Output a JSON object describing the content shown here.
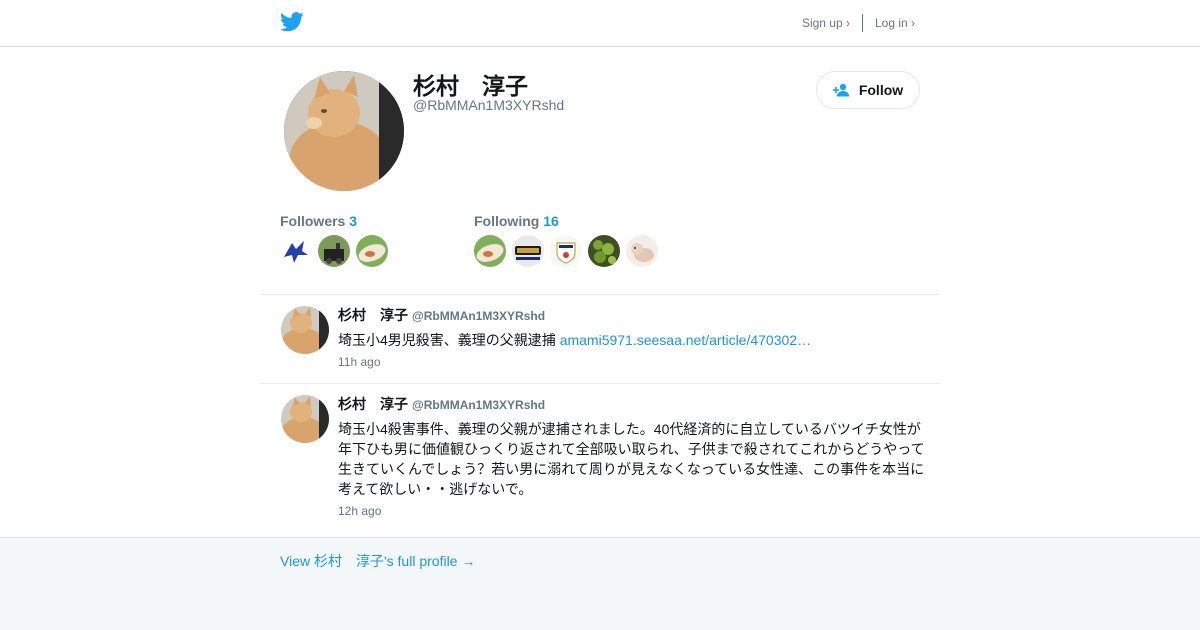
{
  "header": {
    "logo_icon": "twitter-bird-icon",
    "signup_label": "Sign up ›",
    "login_label": "Log in ›"
  },
  "profile": {
    "name": "杉村　淳子",
    "handle": "@RbMMAn1M3XYRshd",
    "follow_label": "Follow",
    "follow_icon": "add-person-icon",
    "followers_label": "Followers",
    "followers_count": "3",
    "following_label": "Following",
    "following_count": "16"
  },
  "tweets": [
    {
      "name": "杉村　淳子",
      "handle": "@RbMMAn1M3XYRshd",
      "text": "埼玉小4男児殺害、義理の父親逮捕 ",
      "link": "amami5971.seesaa.net/article/470302…",
      "time": "11h ago"
    },
    {
      "name": "杉村　淳子",
      "handle": "@RbMMAn1M3XYRshd",
      "text": "埼玉小4殺害事件、義理の父親が逮捕されました。40代経済的に自立しているバツイチ女性が年下ひも男に価値観ひっくり返されて全部吸い取られ、子供まで殺されてこれからどうやって生きていくんでしょう？若い男に溺れて周りが見えなくなっている女性達、この事件を本当に考えて欲しい・・逃げないで。",
      "link": "",
      "time": "12h ago"
    }
  ],
  "footer": {
    "full_profile_label": "View 杉村　淳子's full profile →"
  },
  "colors": {
    "accent": "#1b95e0",
    "twitter_blue": "#1da1f2",
    "muted": "#657786"
  }
}
